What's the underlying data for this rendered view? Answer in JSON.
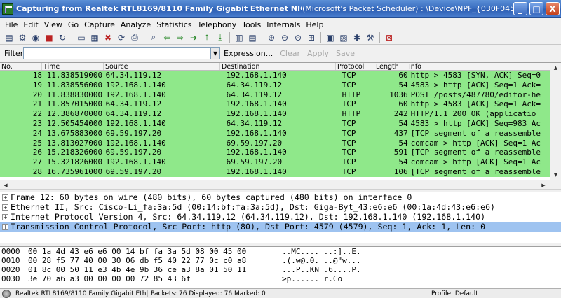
{
  "window": {
    "title_left": "Capturing from Realtek RTL8169/8110 Family Gigabit Ethernet NIC",
    "title_right": "(Microsoft's Packet Scheduler) : \\Device\\NPF_{030F045E-F599-48B...",
    "minimize": "_",
    "maximize": "□",
    "close": "X"
  },
  "menu": [
    "File",
    "Edit",
    "View",
    "Go",
    "Capture",
    "Analyze",
    "Statistics",
    "Telephony",
    "Tools",
    "Internals",
    "Help"
  ],
  "filter": {
    "label": "Filter:",
    "value": "",
    "expression": "Expression...",
    "clear": "Clear",
    "apply": "Apply",
    "save": "Save"
  },
  "columns": [
    "No.",
    "Time",
    "Source",
    "Destination",
    "Protocol",
    "Length",
    "Info"
  ],
  "packets": [
    {
      "no": "18",
      "time": "11.838519000",
      "src": "64.34.119.12",
      "dst": "192.168.1.140",
      "proto": "TCP",
      "len": "60",
      "info": "http > 4583 [SYN, ACK] Seq=0"
    },
    {
      "no": "19",
      "time": "11.838556000",
      "src": "192.168.1.140",
      "dst": "64.34.119.12",
      "proto": "TCP",
      "len": "54",
      "info": "4583 > http [ACK] Seq=1 Ack="
    },
    {
      "no": "20",
      "time": "11.838830000",
      "src": "192.168.1.140",
      "dst": "64.34.119.12",
      "proto": "HTTP",
      "len": "1036",
      "info": "POST /posts/487780/editor-he"
    },
    {
      "no": "21",
      "time": "11.857015000",
      "src": "64.34.119.12",
      "dst": "192.168.1.140",
      "proto": "TCP",
      "len": "60",
      "info": "http > 4583 [ACK] Seq=1 Ack="
    },
    {
      "no": "22",
      "time": "12.386870000",
      "src": "64.34.119.12",
      "dst": "192.168.1.140",
      "proto": "HTTP",
      "len": "242",
      "info": "HTTP/1.1 200 OK  (applicatio"
    },
    {
      "no": "23",
      "time": "12.505454000",
      "src": "192.168.1.140",
      "dst": "64.34.119.12",
      "proto": "TCP",
      "len": "54",
      "info": "4583 > http [ACK] Seq=983 Ac"
    },
    {
      "no": "24",
      "time": "13.675883000",
      "src": "69.59.197.20",
      "dst": "192.168.1.140",
      "proto": "TCP",
      "len": "437",
      "info": "[TCP segment of a reassemble"
    },
    {
      "no": "25",
      "time": "13.813027000",
      "src": "192.168.1.140",
      "dst": "69.59.197.20",
      "proto": "TCP",
      "len": "54",
      "info": "comcam > http [ACK] Seq=1 Ac"
    },
    {
      "no": "26",
      "time": "15.218326000",
      "src": "69.59.197.20",
      "dst": "192.168.1.140",
      "proto": "TCP",
      "len": "591",
      "info": "[TCP segment of a reassemble"
    },
    {
      "no": "27",
      "time": "15.321826000",
      "src": "192.168.1.140",
      "dst": "69.59.197.20",
      "proto": "TCP",
      "len": "54",
      "info": "comcam > http [ACK] Seq=1 Ac"
    },
    {
      "no": "28",
      "time": "16.735961000",
      "src": "69.59.197.20",
      "dst": "192.168.1.140",
      "proto": "TCP",
      "len": "106",
      "info": "[TCP segment of a reassemble"
    }
  ],
  "details": [
    "Frame 12: 60 bytes on wire (480 bits), 60 bytes captured (480 bits) on interface 0",
    "Ethernet II, Src: Cisco-Li_fa:3a:5d (00:14:bf:fa:3a:5d), Dst: Giga-Byt_43:e6:e6 (00:1a:4d:43:e6:e6)",
    "Internet Protocol Version 4, Src: 64.34.119.12 (64.34.119.12), Dst: 192.168.1.140 (192.168.1.140)",
    "Transmission Control Protocol, Src Port: http (80), Dst Port: 4579 (4579), Seq: 1, Ack: 1, Len: 0"
  ],
  "hex": [
    {
      "offset": "0000",
      "bytes": "00 1a 4d 43 e6 e6 00 14  bf fa 3a 5d 08 00 45 00",
      "ascii": "..MC.... ..:]..E."
    },
    {
      "offset": "0010",
      "bytes": "00 28 f5 77 40 00 30 06  db f5 40 22 77 0c c0 a8",
      "ascii": ".(.w@.0. ..@\"w..."
    },
    {
      "offset": "0020",
      "bytes": "01 8c 00 50 11 e3 4b 4e  9b 36 ce a3 8a 01 50 11",
      "ascii": "...P..KN .6....P."
    },
    {
      "offset": "0030",
      "bytes": "3e 70 a6 a3 00 00 00 00  72 85 43 6f",
      "ascii": ">p...... r.Co"
    }
  ],
  "status": {
    "interface": "Realtek RTL8169/8110 Family Gigabit Eth...",
    "packets": "Packets: 76 Displayed: 76 Marked: 0",
    "profile": "Profile: Default"
  },
  "colors": {
    "packet_row": "#8fe88a",
    "selected_detail": "#9ec3f0"
  }
}
